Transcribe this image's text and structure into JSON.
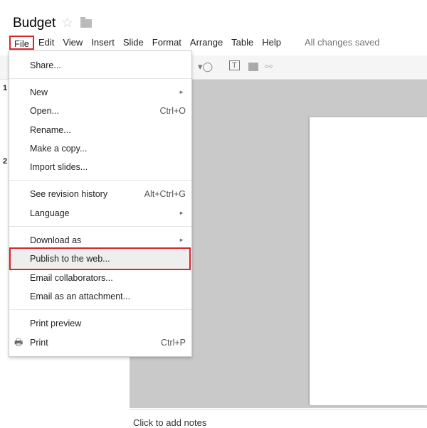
{
  "title": "Budget",
  "menubar": [
    "File",
    "Edit",
    "View",
    "Insert",
    "Slide",
    "Format",
    "Arrange",
    "Table",
    "Help"
  ],
  "status": "All changes saved",
  "slide_numbers": [
    "1",
    "2"
  ],
  "notes_placeholder": "Click to add notes",
  "file_menu": {
    "share": "Share...",
    "new": "New",
    "open": "Open...",
    "open_shortcut": "Ctrl+O",
    "rename": "Rename...",
    "copy": "Make a copy...",
    "import": "Import slides...",
    "revision": "See revision history",
    "revision_shortcut": "Alt+Ctrl+G",
    "language": "Language",
    "download": "Download as",
    "publish": "Publish to the web...",
    "email_collab": "Email collaborators...",
    "email_attach": "Email as an attachment...",
    "print_preview": "Print preview",
    "print": "Print",
    "print_shortcut": "Ctrl+P"
  },
  "colors": {
    "highlight_box": "#d9252a",
    "canvas": "#c9c9c9"
  }
}
